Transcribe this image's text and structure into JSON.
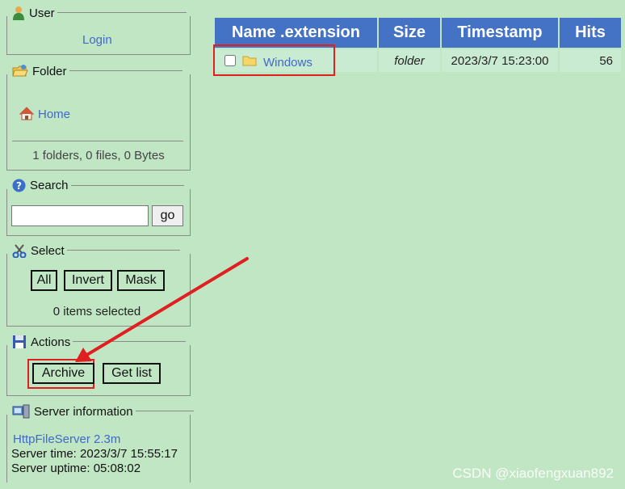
{
  "user": {
    "title": "User",
    "login_label": "Login"
  },
  "folder": {
    "title": "Folder",
    "home_label": "Home",
    "stats": "1 folders, 0 files, 0 Bytes"
  },
  "search": {
    "title": "Search",
    "input_value": "",
    "go_label": "go"
  },
  "select": {
    "title": "Select",
    "all_label": "All",
    "invert_label": "Invert",
    "mask_label": "Mask",
    "status": "0 items selected"
  },
  "actions": {
    "title": "Actions",
    "archive_label": "Archive",
    "getlist_label": "Get list"
  },
  "server": {
    "title": "Server information",
    "software": "HttpFileServer 2.3m",
    "time": "Server time: 2023/3/7 15:55:17",
    "uptime": "Server uptime: 05:08:02"
  },
  "files": {
    "headers": [
      "Name .extension",
      "Size",
      "Timestamp",
      "Hits"
    ],
    "rows": [
      {
        "name": "Windows",
        "size": "folder",
        "timestamp": "2023/3/7 15:23:00",
        "hits": "56"
      }
    ]
  },
  "watermark": "CSDN @xiaofengxuan892",
  "colors": {
    "background": "#c0e6c4",
    "header_blue": "#4472c4",
    "link_blue": "#4169c8",
    "highlight_red": "#e02020"
  }
}
